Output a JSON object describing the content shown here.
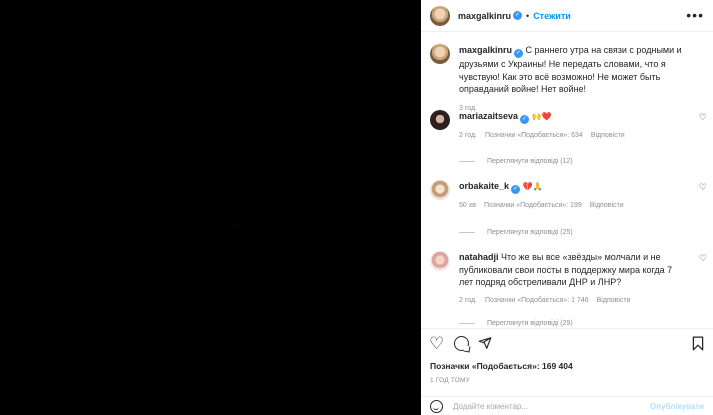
{
  "post": {
    "username": "maxgalkinru",
    "follow_label": "Стежити",
    "more_label": "•••",
    "caption": "С раннего утра на связи с родными и друзьями с Украины! Не передать словами, что я чувствую! Как это всё возможно! Не может быть оправданий войне! Нет войне!",
    "caption_time": "3 год."
  },
  "comments": [
    {
      "username": "mariazaitseva",
      "text": "🙌❤️",
      "time": "2 год.",
      "likes": "Позначки «Подобається»: 634",
      "reply_label": "Відповісти",
      "view_replies": "Переглянути відповіді (12)"
    },
    {
      "username": "orbakaite_k",
      "text": "💔🙏",
      "time": "50 хв",
      "likes": "Позначки «Подобається»: 199",
      "reply_label": "Відповісти",
      "view_replies": "Переглянути відповіді (25)"
    },
    {
      "username": "natahadji",
      "text": "Что же вы все «звёзды» молчали и не публиковали свои посты в поддержку мира когда 7 лет подряд обстреливали ДНР и ЛНР?",
      "time": "2 год.",
      "likes": "Позначки «Подобається»: 1 746",
      "reply_label": "Відповісти",
      "view_replies": "Переглянути відповіді (29)"
    }
  ],
  "footer": {
    "likes": "Позначки «Подобається»: 169 404",
    "posted": "1 ГОД ТОМУ",
    "comment_placeholder": "Додайте коментар...",
    "publish_label": "Опублікувати"
  },
  "icons": [
    "heart-icon",
    "comment-icon",
    "share-icon",
    "bookmark-icon",
    "emoji-icon",
    "verified-icon",
    "more-icon"
  ],
  "colors": {
    "accent": "#0095f6",
    "verified": "#3897f0",
    "muted": "#8e8e8e",
    "media_bg": "#000000"
  }
}
